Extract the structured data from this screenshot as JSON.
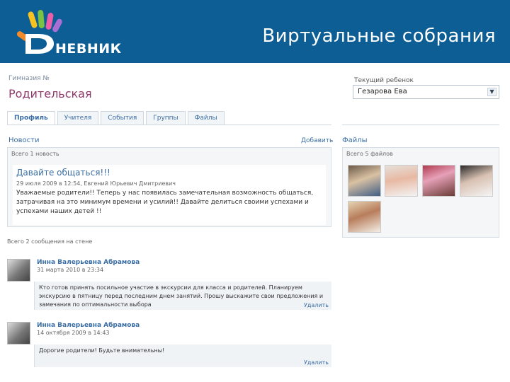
{
  "header": {
    "logo_text": "НЕВНИК",
    "title": "Виртуальные собрания"
  },
  "page": {
    "breadcrumb": "Гимназия №",
    "title": "Родительская",
    "child_label": "Текущий ребенок",
    "child_value": "Гезарова Ева"
  },
  "tabs": [
    {
      "label": "Профиль",
      "active": true
    },
    {
      "label": "Учителя",
      "active": false
    },
    {
      "label": "События",
      "active": false
    },
    {
      "label": "Группы",
      "active": false
    },
    {
      "label": "Файлы",
      "active": false
    }
  ],
  "news": {
    "section_title": "Новости",
    "add_label": "Добавить",
    "count": "Всего 1 новость",
    "headline": "Давайте общаться!!!",
    "meta": "29 июля 2009 в 12:54, Евгений Юрьевич Дмитриевич",
    "text": "Уважаемые родители!! Теперь у нас появилась замечательная возможность общаться, затрачивая на это минимум времени и усилий!! Давайте делиться своими успехами и успехами наших детей !!"
  },
  "files": {
    "section_title": "Файлы",
    "count": "Всего 5 файлов"
  },
  "wall": {
    "count": "Всего 2 сообщения на стене",
    "posts": [
      {
        "author": "Инна Валерьевна Абрамова",
        "date": "31 марта 2010 в 23:34",
        "text": "Кто готов принять посильное участие в экскурсии для класса и родителей. Планируем экскурсию в пятницу перед последним днем занятий. Прошу выскажите свои предложения и замечания по оптимальности выбора",
        "delete": "Удалить"
      },
      {
        "author": "Инна Валерьевна Абрамова",
        "date": "14 октября 2009 в 14:43",
        "text": "Дорогие родители! Будьте внимательны!",
        "delete": "Удалить"
      }
    ]
  }
}
